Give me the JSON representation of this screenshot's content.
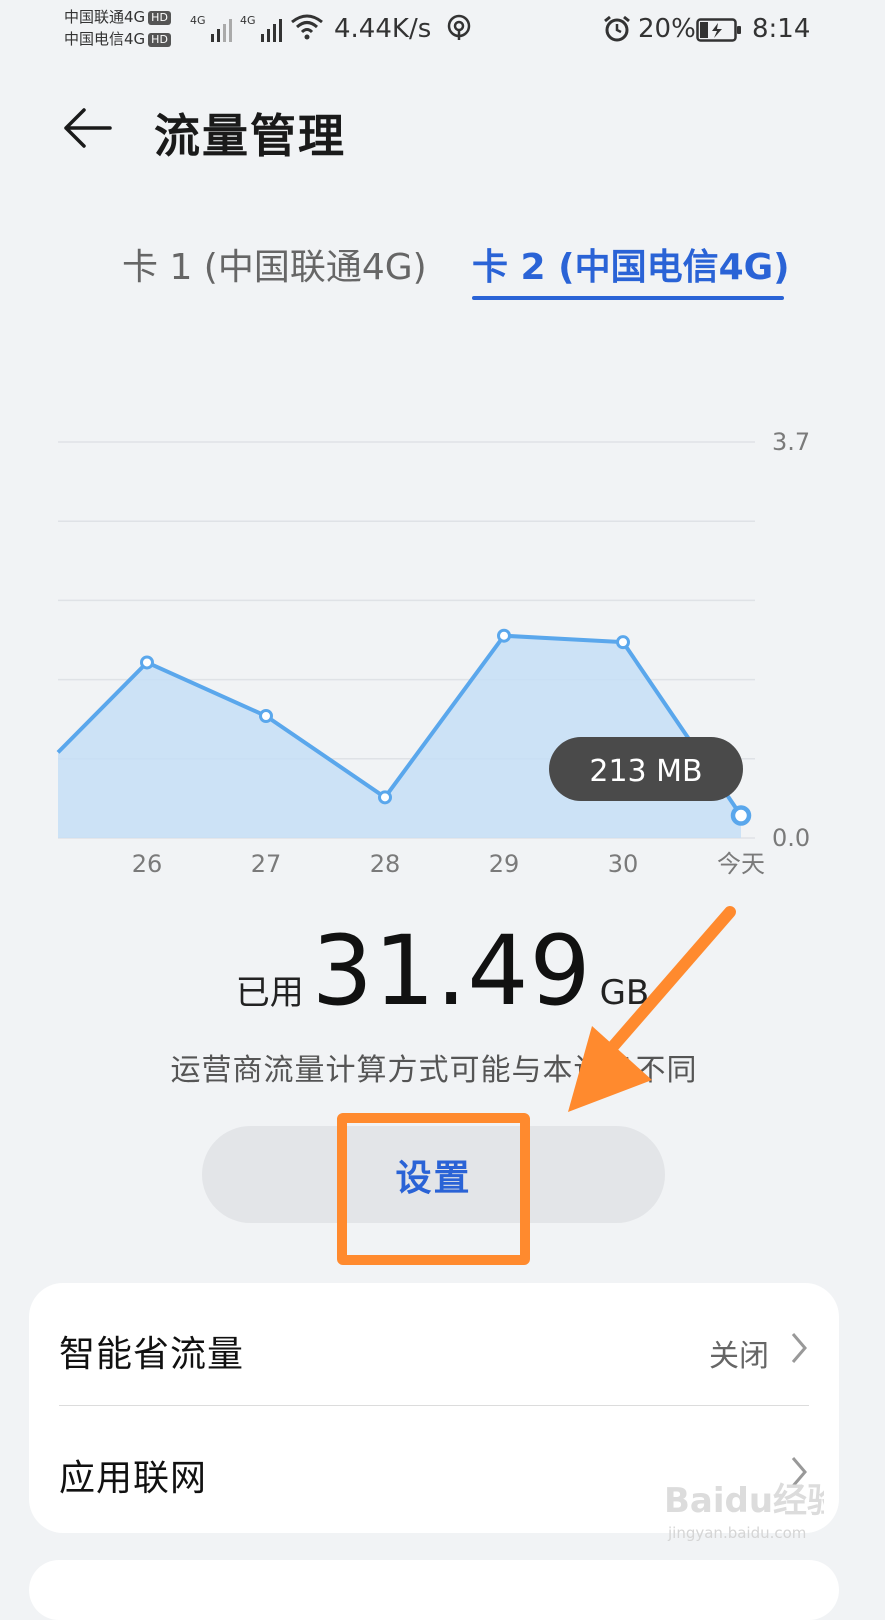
{
  "status_bar": {
    "carrier1": "中国联通4G",
    "carrier2": "中国电信4G",
    "hd_badge": "HD",
    "signal_label": "4G",
    "net_speed": "4.44K/s",
    "battery_percent": "20%",
    "time": "8:14",
    "icons": [
      "signal-icon",
      "wifi-icon",
      "hotspot-icon",
      "alarm-icon",
      "battery-charging-icon"
    ]
  },
  "header": {
    "title": "流量管理",
    "back_icon": "back-arrow-icon"
  },
  "tabs": [
    {
      "label": "卡 1 (中国联通4G)",
      "active": false
    },
    {
      "label": "卡 2 (中国电信4G)",
      "active": true
    }
  ],
  "chart_data": {
    "type": "area",
    "categories": [
      "26",
      "27",
      "28",
      "29",
      "30",
      "今天"
    ],
    "values": [
      1.64,
      1.14,
      0.38,
      1.89,
      1.83,
      0.21
    ],
    "leading_value": 0.8,
    "y_tick_labels": [
      "3.7",
      "0.0"
    ],
    "ylim": [
      0,
      3.7
    ],
    "tooltip": "213 MB",
    "grid": true,
    "colors": {
      "line": "#5aa7ec",
      "fill": "#c5def6",
      "grid": "#dfe2e6"
    }
  },
  "usage": {
    "prefix": "已用",
    "value": "31.49",
    "unit": "GB"
  },
  "note": "运营商流量计算方式可能与本设备不同",
  "settings_button": {
    "label": "设置"
  },
  "list": [
    {
      "title": "智能省流量",
      "value": "关闭",
      "icon": "chevron-right-icon"
    },
    {
      "title": "应用联网",
      "value": "",
      "icon": "chevron-right-icon"
    }
  ],
  "colors": {
    "accent": "#2a63d6",
    "annotation": "#ff8a2e",
    "background": "#f1f3f5"
  },
  "watermark": {
    "text": "Baidu经验",
    "sub": "jingyan.baidu.com"
  }
}
